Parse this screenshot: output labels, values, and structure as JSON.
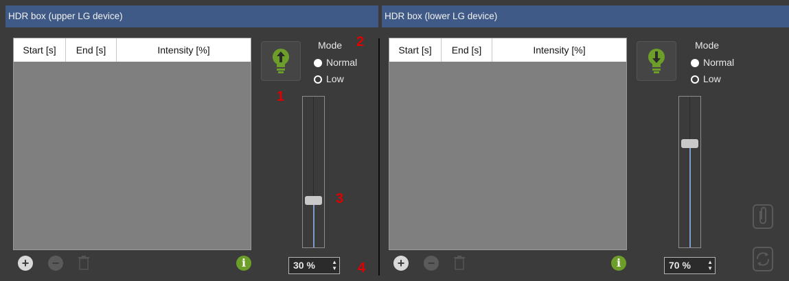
{
  "upper": {
    "title": "HDR box (upper LG device)",
    "columns": [
      "Start [s]",
      "End [s]",
      "Intensity [%]"
    ],
    "mode_label": "Mode",
    "mode_options": [
      "Normal",
      "Low"
    ],
    "mode_selected": "Normal",
    "intensity_value": "30 %",
    "intensity_fraction": 0.3,
    "bulb_icon": "bulb-up-arrow-icon"
  },
  "lower": {
    "title": "HDR box (lower LG device)",
    "columns": [
      "Start [s]",
      "End [s]",
      "Intensity [%]"
    ],
    "mode_label": "Mode",
    "mode_options": [
      "Normal",
      "Low"
    ],
    "mode_selected": "Normal",
    "intensity_value": "70 %",
    "intensity_fraction": 0.7,
    "bulb_icon": "bulb-down-arrow-icon"
  },
  "callouts": [
    "1",
    "2",
    "3",
    "4"
  ],
  "colors": {
    "header": "#3f5a87",
    "accent": "#6e9e2a",
    "slider_fill": "#7d9ccf",
    "callout": "#e00000"
  }
}
